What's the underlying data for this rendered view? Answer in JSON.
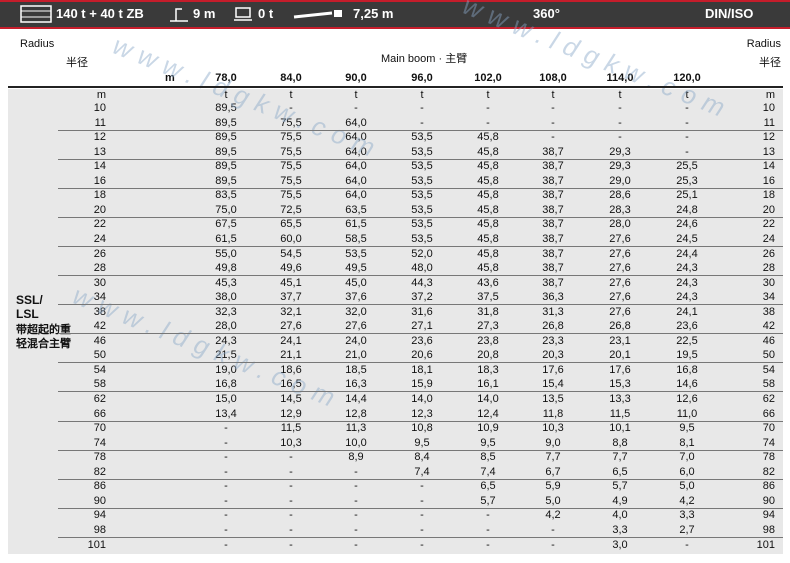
{
  "top": {
    "counterweight": "140 t + 40 t ZB",
    "superlift_radius": "9 m",
    "ballast": "0 t",
    "extension": "7,25 m",
    "slew": "360°",
    "norm": "DIN/ISO"
  },
  "header": {
    "radius_en": "Radius",
    "radius_cn": "半径",
    "boom_title": "Main boom · 主臂",
    "unit_label": "m",
    "unit_t": "t",
    "unit_m": "m"
  },
  "side_label": {
    "en1": "SSL/",
    "en2": "LSL",
    "cn1": "带超起的重",
    "cn2": "轻混合主臂"
  },
  "watermark": "www.ldgkw.com",
  "chart_data": {
    "type": "table",
    "boom_lengths": [
      "78,0",
      "84,0",
      "90,0",
      "96,0",
      "102,0",
      "108,0",
      "114,0",
      "120,0"
    ],
    "rows": [
      {
        "r": "10",
        "v": [
          "89,5",
          "-",
          "-",
          "-",
          "-",
          "-",
          "-",
          "-"
        ]
      },
      {
        "r": "11",
        "v": [
          "89,5",
          "75,5",
          "64,0",
          "-",
          "-",
          "-",
          "-",
          "-"
        ]
      },
      {
        "r": "12",
        "v": [
          "89,5",
          "75,5",
          "64,0",
          "53,5",
          "45,8",
          "-",
          "-",
          "-"
        ]
      },
      {
        "r": "13",
        "v": [
          "89,5",
          "75,5",
          "64,0",
          "53,5",
          "45,8",
          "38,7",
          "29,3",
          "-"
        ]
      },
      {
        "r": "14",
        "v": [
          "89,5",
          "75,5",
          "64,0",
          "53,5",
          "45,8",
          "38,7",
          "29,3",
          "25,5"
        ]
      },
      {
        "r": "16",
        "v": [
          "89,5",
          "75,5",
          "64,0",
          "53,5",
          "45,8",
          "38,7",
          "29,0",
          "25,3"
        ]
      },
      {
        "r": "18",
        "v": [
          "83,5",
          "75,5",
          "64,0",
          "53,5",
          "45,8",
          "38,7",
          "28,6",
          "25,1"
        ]
      },
      {
        "r": "20",
        "v": [
          "75,0",
          "72,5",
          "63,5",
          "53,5",
          "45,8",
          "38,7",
          "28,3",
          "24,8"
        ]
      },
      {
        "r": "22",
        "v": [
          "67,5",
          "65,5",
          "61,5",
          "53,5",
          "45,8",
          "38,7",
          "28,0",
          "24,6"
        ]
      },
      {
        "r": "24",
        "v": [
          "61,5",
          "60,0",
          "58,5",
          "53,5",
          "45,8",
          "38,7",
          "27,6",
          "24,5"
        ]
      },
      {
        "r": "26",
        "v": [
          "55,0",
          "54,5",
          "53,5",
          "52,0",
          "45,8",
          "38,7",
          "27,6",
          "24,4"
        ]
      },
      {
        "r": "28",
        "v": [
          "49,8",
          "49,6",
          "49,5",
          "48,0",
          "45,8",
          "38,7",
          "27,6",
          "24,3"
        ]
      },
      {
        "r": "30",
        "v": [
          "45,3",
          "45,1",
          "45,0",
          "44,3",
          "43,6",
          "38,7",
          "27,6",
          "24,3"
        ]
      },
      {
        "r": "34",
        "v": [
          "38,0",
          "37,7",
          "37,6",
          "37,2",
          "37,5",
          "36,3",
          "27,6",
          "24,3"
        ]
      },
      {
        "r": "38",
        "v": [
          "32,3",
          "32,1",
          "32,0",
          "31,6",
          "31,8",
          "31,3",
          "27,6",
          "24,1"
        ]
      },
      {
        "r": "42",
        "v": [
          "28,0",
          "27,6",
          "27,6",
          "27,1",
          "27,3",
          "26,8",
          "26,8",
          "23,6"
        ]
      },
      {
        "r": "46",
        "v": [
          "24,3",
          "24,1",
          "24,0",
          "23,6",
          "23,8",
          "23,3",
          "23,1",
          "22,5"
        ]
      },
      {
        "r": "50",
        "v": [
          "21,5",
          "21,1",
          "21,0",
          "20,6",
          "20,8",
          "20,3",
          "20,1",
          "19,5"
        ]
      },
      {
        "r": "54",
        "v": [
          "19,0",
          "18,6",
          "18,5",
          "18,1",
          "18,3",
          "17,6",
          "17,6",
          "16,8"
        ]
      },
      {
        "r": "58",
        "v": [
          "16,8",
          "16,5",
          "16,3",
          "15,9",
          "16,1",
          "15,4",
          "15,3",
          "14,6"
        ]
      },
      {
        "r": "62",
        "v": [
          "15,0",
          "14,5",
          "14,4",
          "14,0",
          "14,0",
          "13,5",
          "13,3",
          "12,6"
        ]
      },
      {
        "r": "66",
        "v": [
          "13,4",
          "12,9",
          "12,8",
          "12,3",
          "12,4",
          "11,8",
          "11,5",
          "11,0"
        ]
      },
      {
        "r": "70",
        "v": [
          "-",
          "11,5",
          "11,3",
          "10,8",
          "10,9",
          "10,3",
          "10,1",
          "9,5"
        ]
      },
      {
        "r": "74",
        "v": [
          "-",
          "10,3",
          "10,0",
          "9,5",
          "9,5",
          "9,0",
          "8,8",
          "8,1"
        ]
      },
      {
        "r": "78",
        "v": [
          "-",
          "-",
          "8,9",
          "8,4",
          "8,5",
          "7,7",
          "7,7",
          "7,0"
        ]
      },
      {
        "r": "82",
        "v": [
          "-",
          "-",
          "-",
          "7,4",
          "7,4",
          "6,7",
          "6,5",
          "6,0"
        ]
      },
      {
        "r": "86",
        "v": [
          "-",
          "-",
          "-",
          "-",
          "6,5",
          "5,9",
          "5,7",
          "5,0"
        ]
      },
      {
        "r": "90",
        "v": [
          "-",
          "-",
          "-",
          "-",
          "5,7",
          "5,0",
          "4,9",
          "4,2"
        ]
      },
      {
        "r": "94",
        "v": [
          "-",
          "-",
          "-",
          "-",
          "-",
          "4,2",
          "4,0",
          "3,3"
        ]
      },
      {
        "r": "98",
        "v": [
          "-",
          "-",
          "-",
          "-",
          "-",
          "-",
          "3,3",
          "2,7"
        ]
      },
      {
        "r": "101",
        "v": [
          "-",
          "-",
          "-",
          "-",
          "-",
          "-",
          "3,0",
          "-"
        ]
      }
    ]
  }
}
